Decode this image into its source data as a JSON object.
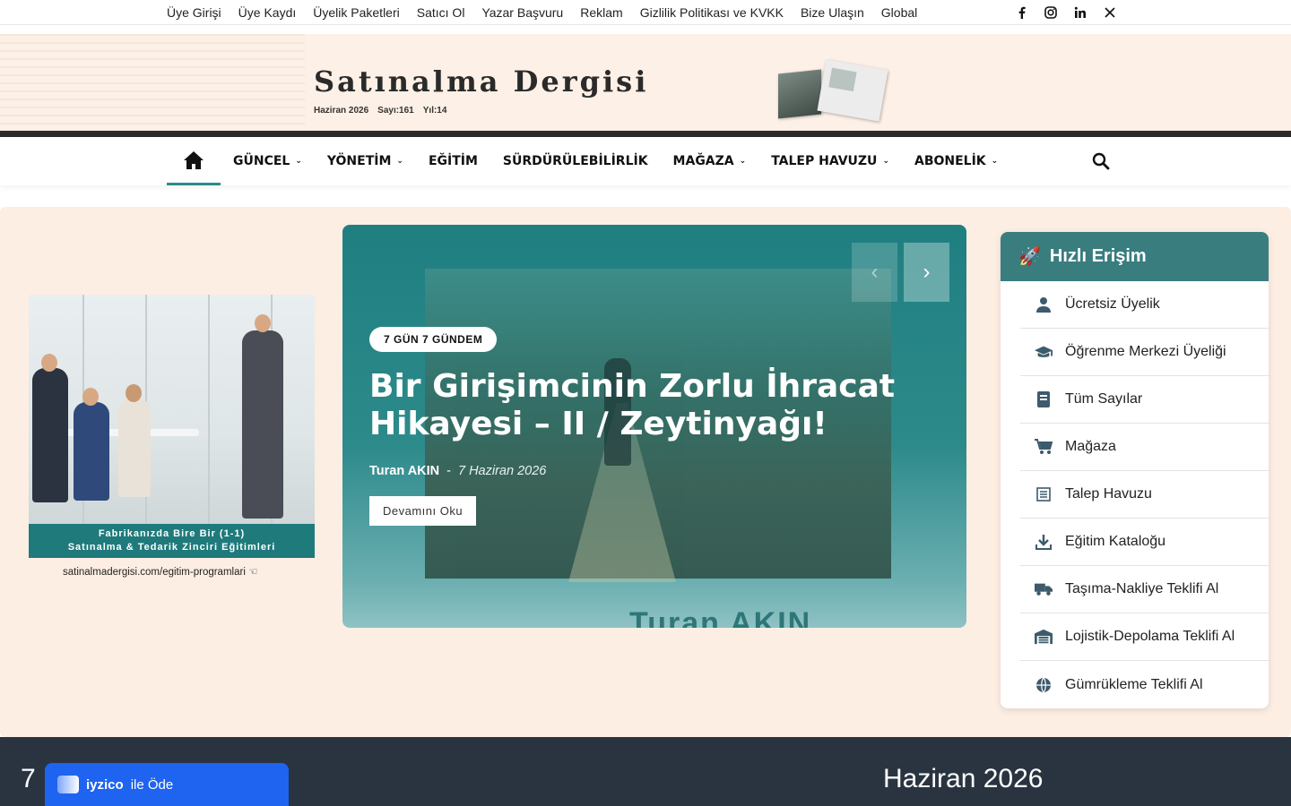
{
  "topbar": {
    "links": [
      "Üye Girişi",
      "Üye Kaydı",
      "Üyelik Paketleri",
      "Satıcı Ol",
      "Yazar Başvuru",
      "Reklam",
      "Gizlilik Politikası ve KVKK",
      "Bize Ulaşın",
      "Global"
    ],
    "social": [
      "facebook-icon",
      "instagram-icon",
      "linkedin-icon",
      "x-icon"
    ]
  },
  "banner": {
    "title": "Satınalma Dergisi",
    "issue_month": "Haziran 2026",
    "issue_number": "Sayı:161",
    "issue_year": "Yıl:14"
  },
  "nav": {
    "items": [
      {
        "label": "GÜNCEL",
        "dropdown": true
      },
      {
        "label": "YÖNETİM",
        "dropdown": true
      },
      {
        "label": "EĞİTİM",
        "dropdown": false
      },
      {
        "label": "SÜRDÜRÜLEBİLİRLİK",
        "dropdown": false
      },
      {
        "label": "MAĞAZA",
        "dropdown": true
      },
      {
        "label": "TALEP HAVUZU",
        "dropdown": true
      },
      {
        "label": "ABONELİK",
        "dropdown": true
      }
    ],
    "active_color": "#2a8a8a"
  },
  "ad": {
    "caption_line1": "Fabrikanızda Bire Bir (1-1)",
    "caption_line2": "Satınalma & Tedarik Zinciri Eğitimleri",
    "url": "satinalmadergisi.com/egitim-programlari"
  },
  "slider": {
    "category": "7 GÜN 7 GÜNDEM",
    "headline": "Bir Girişimcinin Zorlu İhracat Hikayesi – II / Zeytinyağı!",
    "author": "Turan AKIN",
    "separator": "-",
    "date": "7 Haziran 2026",
    "read_more": "Devamını Oku",
    "image_text": "Turan AKIN"
  },
  "quick_access": {
    "title": "Hızlı Erişim",
    "items": [
      {
        "label": "Ücretsiz Üyelik",
        "icon": "user-icon"
      },
      {
        "label": "Öğrenme Merkezi Üyeliği",
        "icon": "graduation-cap-icon"
      },
      {
        "label": "Tüm Sayılar",
        "icon": "book-icon"
      },
      {
        "label": "Mağaza",
        "icon": "cart-icon"
      },
      {
        "label": "Talep Havuzu",
        "icon": "list-icon"
      },
      {
        "label": "Eğitim Kataloğu",
        "icon": "download-icon"
      },
      {
        "label": "Taşıma-Nakliye Teklifi Al",
        "icon": "truck-icon"
      },
      {
        "label": "Lojistik-Depolama Teklifi Al",
        "icon": "warehouse-icon"
      },
      {
        "label": "Gümrükleme Teklifi Al",
        "icon": "globe-icon"
      }
    ]
  },
  "footer": {
    "number": "7",
    "month": "Haziran 2026"
  },
  "iyzico": {
    "brand": "iyzico",
    "rest": "ile Öde"
  }
}
